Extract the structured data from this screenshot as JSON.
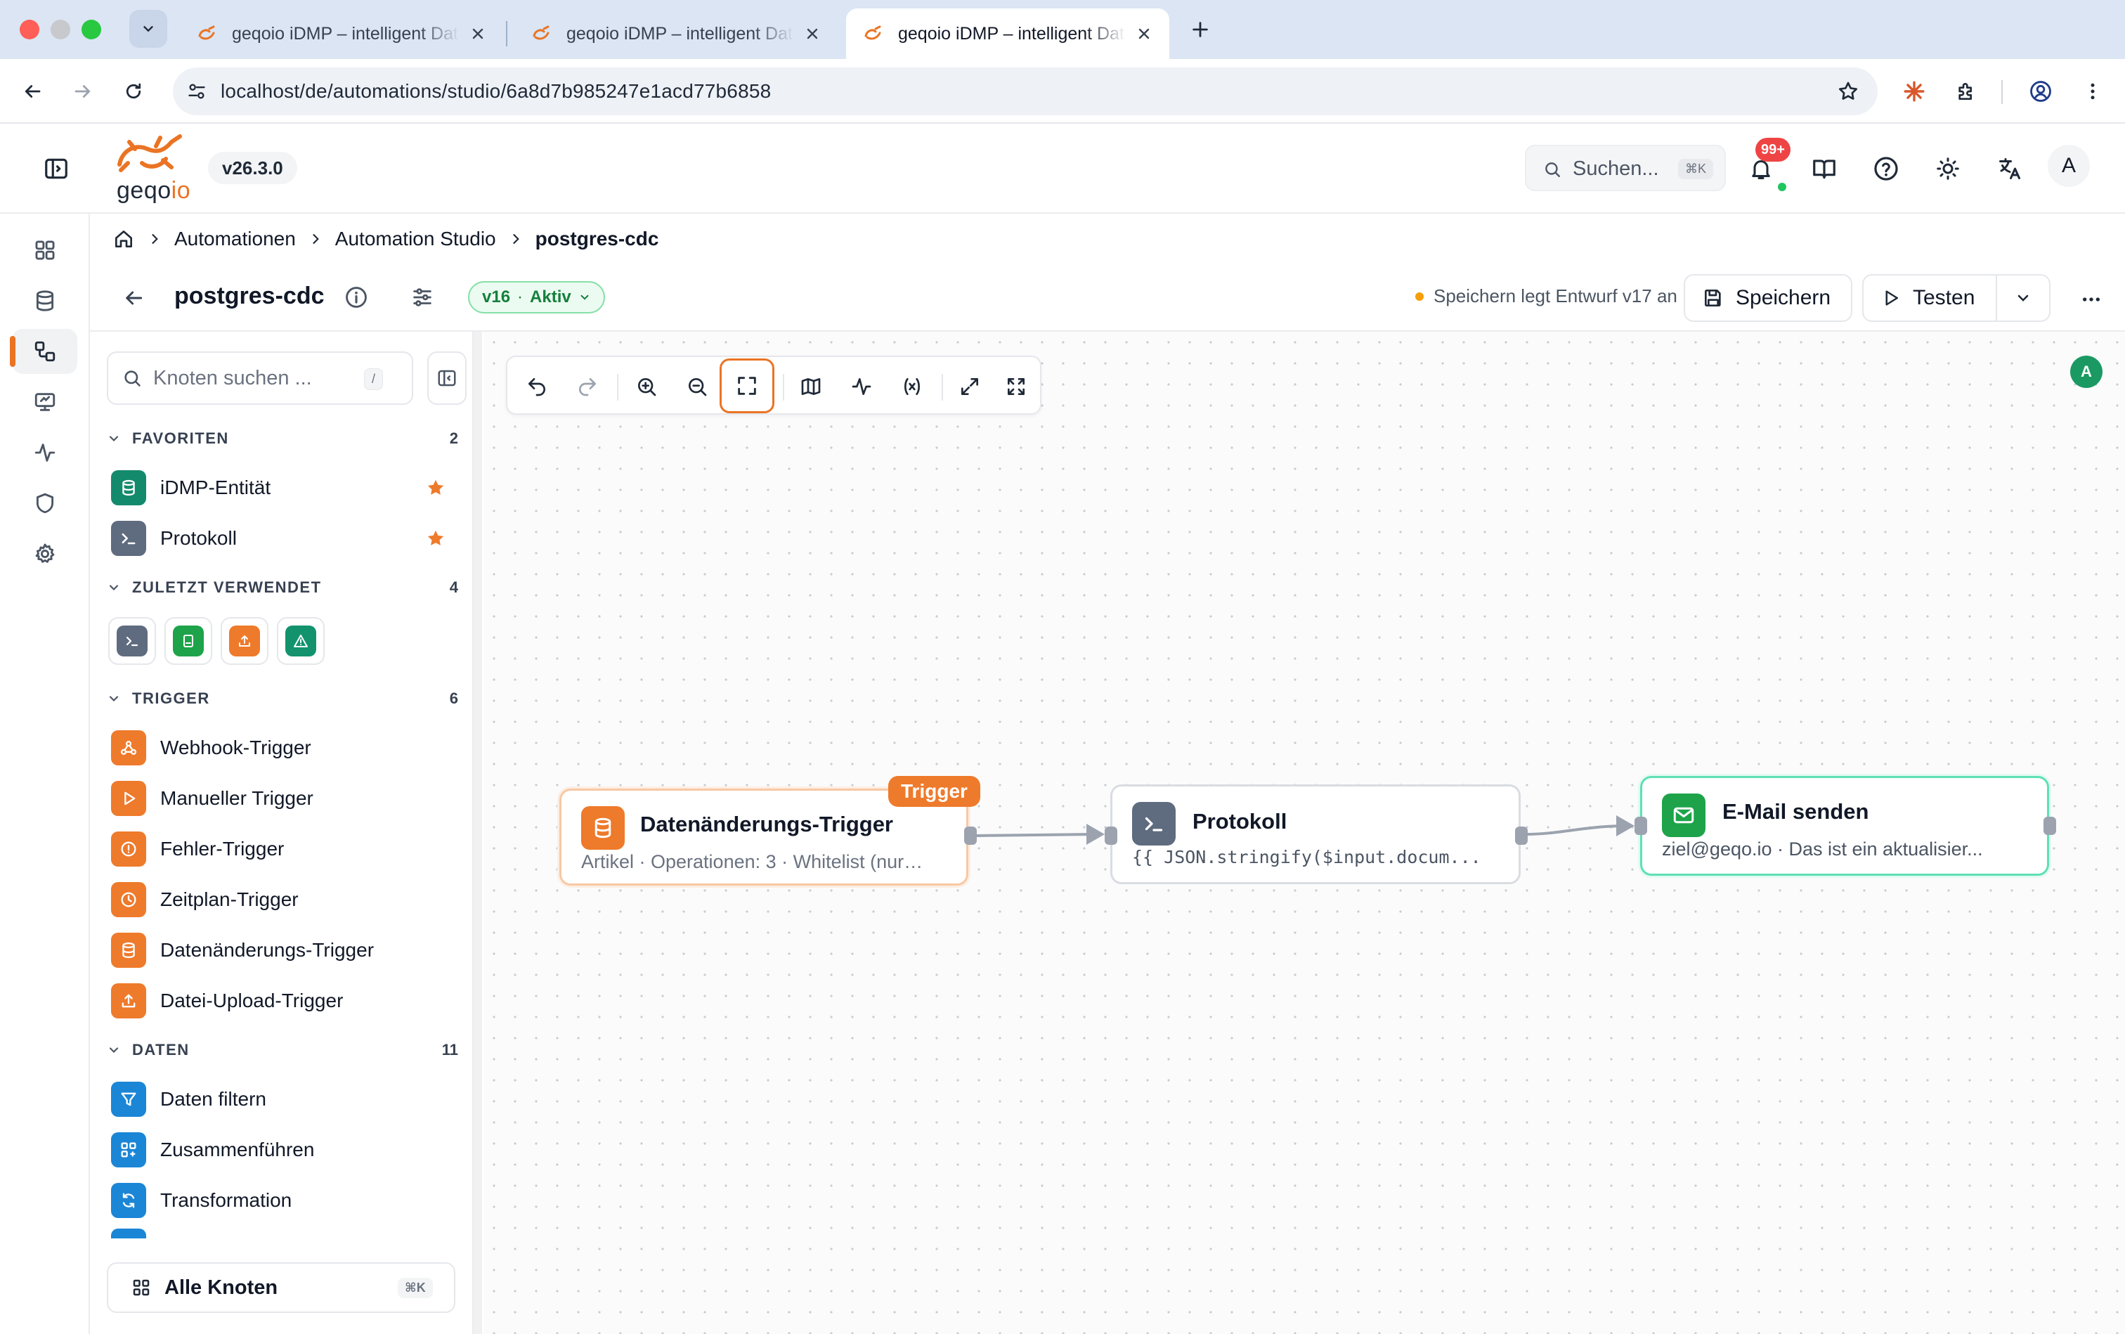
{
  "browser": {
    "tabs": [
      {
        "title": "geqoio iDMP – intelligent Data Management Platform",
        "active": false
      },
      {
        "title": "geqoio iDMP – intelligent Data Management Platform",
        "active": false
      },
      {
        "title": "geqoio iDMP – intelligent Data Management Platform",
        "active": true
      }
    ],
    "url": "localhost/de/automations/studio/6a8d7b985247e1acd77b6858"
  },
  "app": {
    "logo_text": "geqo",
    "logo_accent": "io",
    "version": "v26.3.0",
    "search_placeholder": "Suchen...",
    "search_shortcut": "⌘K",
    "notifications_badge": "99+",
    "avatar_initial": "A"
  },
  "breadcrumb": {
    "items": [
      "Automationen",
      "Automation Studio"
    ],
    "current": "postgres-cdc"
  },
  "page": {
    "title": "postgres-cdc",
    "version_label": "v16",
    "status_label": "Aktiv",
    "draft_note": "Speichern legt Entwurf v17 an",
    "save_label": "Speichern",
    "test_label": "Testen"
  },
  "palette": {
    "search_placeholder": "Knoten suchen ...",
    "search_shortcut": "/",
    "sections": {
      "favorites": {
        "label": "FAVORITEN",
        "count": "2",
        "items": [
          "iDMP-Entität",
          "Protokoll"
        ]
      },
      "recent": {
        "label": "ZULETZT VERWENDET",
        "count": "4"
      },
      "trigger": {
        "label": "TRIGGER",
        "count": "6",
        "items": [
          "Webhook-Trigger",
          "Manueller Trigger",
          "Fehler-Trigger",
          "Zeitplan-Trigger",
          "Datenänderungs-Trigger",
          "Datei-Upload-Trigger"
        ]
      },
      "data": {
        "label": "DATEN",
        "count": "11",
        "items": [
          "Daten filtern",
          "Zusammenführen",
          "Transformation"
        ]
      }
    },
    "all_nodes_label": "Alle Knoten",
    "all_nodes_shortcut": "⌘K"
  },
  "canvas": {
    "presence_initial": "A",
    "nodes": {
      "trigger": {
        "title": "Datenänderungs-Trigger",
        "subtitle": "Artikel · Operationen: 3 · Whitelist (nur…",
        "tag": "Trigger"
      },
      "log": {
        "title": "Protokoll",
        "subtitle": "{{ JSON.stringify($input.docum..."
      },
      "email": {
        "title": "E-Mail senden",
        "subtitle": "ziel@geqo.io · Das ist ein aktualisier..."
      }
    }
  },
  "colors": {
    "accent": "#ea7424",
    "trigger_orange": "#ee7a2b",
    "success_green": "#16a34a",
    "email_border": "#5ee0b5",
    "data_blue": "#1b86d6"
  }
}
